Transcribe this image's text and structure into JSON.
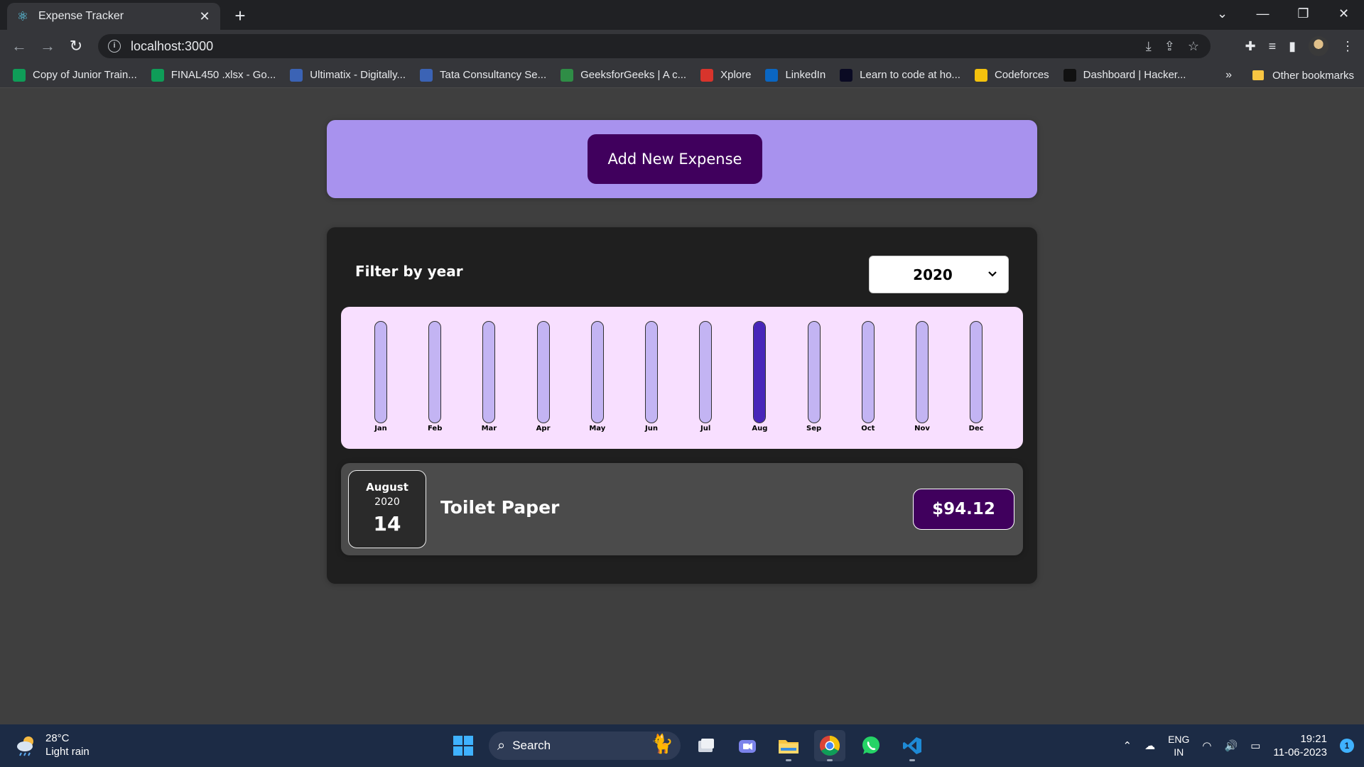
{
  "browser": {
    "tab_title": "Expense Tracker",
    "url": "localhost:3000",
    "bookmarks": [
      {
        "label": "Copy of Junior Train...",
        "icon": "sheets-icon",
        "color": "#0f9d58"
      },
      {
        "label": "FINAL450 .xlsx - Go...",
        "icon": "sheets-icon",
        "color": "#0f9d58"
      },
      {
        "label": "Ultimatix - Digitally...",
        "icon": "tata-icon",
        "color": "#3b63b5"
      },
      {
        "label": "Tata Consultancy Se...",
        "icon": "tata-icon",
        "color": "#3b63b5"
      },
      {
        "label": "GeeksforGeeks | A c...",
        "icon": "gfg-icon",
        "color": "#2f8d46"
      },
      {
        "label": "Xplore",
        "icon": "xplore-icon",
        "color": "#d8342c"
      },
      {
        "label": "LinkedIn",
        "icon": "linkedin-icon",
        "color": "#0a66c2"
      },
      {
        "label": "Learn to code at ho...",
        "icon": "freecodecamp-icon",
        "color": "#0a0a23"
      },
      {
        "label": "Codeforces",
        "icon": "codeforces-icon",
        "color": "#f4c20d"
      },
      {
        "label": "Dashboard | Hacker...",
        "icon": "hackerrank-icon",
        "color": "#111111"
      }
    ],
    "bookmarks_more": "»",
    "other_bookmarks": "Other bookmarks"
  },
  "app": {
    "add_button_label": "Add New Expense",
    "filter_label": "Filter by year",
    "selected_year": "2020",
    "chart_data": {
      "type": "bar",
      "categories": [
        "Jan",
        "Feb",
        "Mar",
        "Apr",
        "May",
        "Jun",
        "Jul",
        "Aug",
        "Sep",
        "Oct",
        "Nov",
        "Dec"
      ],
      "values": [
        0,
        0,
        0,
        0,
        0,
        0,
        0,
        94.12,
        0,
        0,
        0,
        0
      ],
      "max": 94.12,
      "xlabel": "",
      "ylabel": "",
      "colors": {
        "fill": "#4826b9",
        "empty": "#c3b4f3"
      }
    },
    "expenses": [
      {
        "month": "August",
        "year": "2020",
        "day": "14",
        "title": "Toilet Paper",
        "amount": "$94.12"
      }
    ]
  },
  "taskbar": {
    "temperature": "28°C",
    "weather": "Light rain",
    "search_label": "Search",
    "lang_top": "ENG",
    "lang_bottom": "IN",
    "time": "19:21",
    "date": "11-06-2023",
    "notification_count": "1"
  }
}
